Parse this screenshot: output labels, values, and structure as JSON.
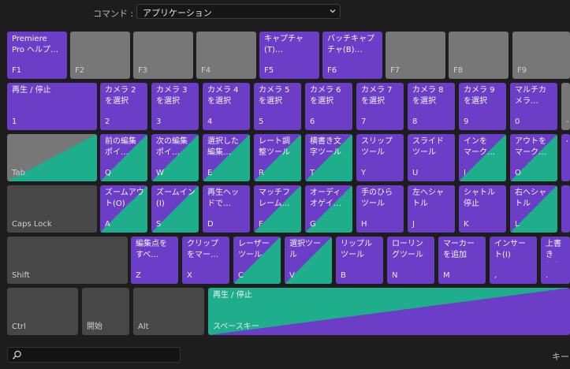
{
  "header": {
    "command_label": "コマンド :",
    "command_value": "アプリケーション"
  },
  "rows": [
    [
      {
        "id": "f1",
        "label": "Premiere\nPro ヘルプ…",
        "key": "F1",
        "style": "purple"
      },
      {
        "id": "f2",
        "label": "",
        "key": "F2",
        "style": "gray"
      },
      {
        "id": "f3",
        "label": "",
        "key": "F3",
        "style": "gray"
      },
      {
        "id": "f4",
        "label": "",
        "key": "F4",
        "style": "gray"
      },
      {
        "id": "f5",
        "label": "キャプチャ\n(T)…",
        "key": "F5",
        "style": "purple"
      },
      {
        "id": "f6",
        "label": "バッチキャプ\nチャ(B)…",
        "key": "F6",
        "style": "purple"
      },
      {
        "id": "f7",
        "label": "",
        "key": "F7",
        "style": "gray"
      },
      {
        "id": "f8",
        "label": "",
        "key": "F8",
        "style": "gray"
      },
      {
        "id": "f9",
        "label": "",
        "key": "F9",
        "style": "gray"
      }
    ],
    [
      {
        "id": "1",
        "label": "再生 / 停止",
        "key": "1",
        "style": "purple"
      },
      {
        "id": "2",
        "label": "カメラ 2\nを選択",
        "key": "2",
        "style": "purple"
      },
      {
        "id": "3",
        "label": "カメラ 3\nを選択",
        "key": "3",
        "style": "purple"
      },
      {
        "id": "4",
        "label": "カメラ 4\nを選択",
        "key": "4",
        "style": "purple"
      },
      {
        "id": "5",
        "label": "カメラ 5\nを選択",
        "key": "5",
        "style": "purple"
      },
      {
        "id": "6",
        "label": "カメラ 6\nを選択",
        "key": "6",
        "style": "purple"
      },
      {
        "id": "7",
        "label": "カメラ 7\nを選択",
        "key": "7",
        "style": "purple"
      },
      {
        "id": "8",
        "label": "カメラ 8\nを選択",
        "key": "8",
        "style": "purple"
      },
      {
        "id": "9",
        "label": "カメラ 9\nを選択",
        "key": "9",
        "style": "purple"
      },
      {
        "id": "0",
        "label": "マルチカ\nメラ…",
        "key": "0",
        "style": "purple"
      },
      {
        "id": "minus",
        "label": "",
        "key": "-",
        "style": "gray"
      }
    ],
    [
      {
        "id": "tab",
        "label": "",
        "key": "Tab",
        "style": "tab-split"
      },
      {
        "id": "q",
        "label": "前の編集\nポイ…",
        "key": "Q",
        "style": "split"
      },
      {
        "id": "w",
        "label": "次の編集\nポイ…",
        "key": "W",
        "style": "split"
      },
      {
        "id": "e",
        "label": "選択した\n編集…",
        "key": "E",
        "style": "split"
      },
      {
        "id": "r",
        "label": "レート調\n整ツール",
        "key": "R",
        "style": "split"
      },
      {
        "id": "t",
        "label": "横書き文\n字ツール",
        "key": "T",
        "style": "split"
      },
      {
        "id": "y",
        "label": "スリップ\nツール",
        "key": "Y",
        "style": "purple"
      },
      {
        "id": "u",
        "label": "スライド\nツール",
        "key": "U",
        "style": "purple"
      },
      {
        "id": "i",
        "label": "インを\nマーク…",
        "key": "I",
        "style": "split"
      },
      {
        "id": "o",
        "label": "アウトを\nマーク…",
        "key": "O",
        "style": "split"
      },
      {
        "id": "p",
        "label": "ペ",
        "key": "",
        "style": "purple"
      }
    ],
    [
      {
        "id": "capslock",
        "label": "",
        "key": "Caps Lock",
        "style": "dark"
      },
      {
        "id": "a",
        "label": "ズームアウ\nト(O)",
        "key": "A",
        "style": "split"
      },
      {
        "id": "s",
        "label": "ズームイン\n(I)",
        "key": "S",
        "style": "split"
      },
      {
        "id": "d",
        "label": "再生ヘッ\nドで…",
        "key": "D",
        "style": "purple"
      },
      {
        "id": "f",
        "label": "マッチフ\nレーム…",
        "key": "F",
        "style": "split"
      },
      {
        "id": "g",
        "label": "オーディ\nオゲイ…",
        "key": "G",
        "style": "split"
      },
      {
        "id": "h",
        "label": "手のひら\nツール",
        "key": "H",
        "style": "purple"
      },
      {
        "id": "j",
        "label": "左へシャ\nトル",
        "key": "J",
        "style": "purple"
      },
      {
        "id": "k",
        "label": "シャトル\n停止",
        "key": "K",
        "style": "purple"
      },
      {
        "id": "l",
        "label": "右へシャ\nトル",
        "key": "L",
        "style": "split"
      },
      {
        "id": "semi",
        "label": "",
        "key": "",
        "style": "purple"
      }
    ],
    [
      {
        "id": "shift",
        "label": "",
        "key": "Shift",
        "style": "dark"
      },
      {
        "id": "z",
        "label": "編集点を\nすべ…",
        "key": "Z",
        "style": "purple"
      },
      {
        "id": "x",
        "label": "クリップ\nをマー…",
        "key": "X",
        "style": "purple"
      },
      {
        "id": "c",
        "label": "レーザー\nツール",
        "key": "C",
        "style": "split"
      },
      {
        "id": "v",
        "label": "選択ツー\nル",
        "key": "V",
        "style": "split"
      },
      {
        "id": "b",
        "label": "リップル\nツール",
        "key": "B",
        "style": "purple"
      },
      {
        "id": "n",
        "label": "ローリン\nグツール",
        "key": "N",
        "style": "purple"
      },
      {
        "id": "m",
        "label": "マーカー\nを追加",
        "key": "M",
        "style": "purple"
      },
      {
        "id": "comma",
        "label": "インサー\nト(I)",
        "key": ",",
        "style": "purple"
      },
      {
        "id": "period",
        "label": "上書き\n(O)",
        "key": ".",
        "style": "purple"
      }
    ],
    [
      {
        "id": "ctrl",
        "label": "",
        "key": "Ctrl",
        "style": "dark"
      },
      {
        "id": "start",
        "label": "",
        "key": "開始",
        "style": "dark"
      },
      {
        "id": "alt",
        "label": "",
        "key": "Alt",
        "style": "dark"
      },
      {
        "id": "space",
        "label": "再生 / 停止",
        "key": "スペースキー",
        "style": "space-split"
      }
    ]
  ],
  "footer": {
    "search_placeholder": "",
    "right_text": "キー"
  },
  "colors": {
    "purple": "#6c3ec7",
    "teal": "#1fae8b",
    "gray": "#777777",
    "dark": "#474747",
    "background": "#1d1d1d"
  },
  "icons": {
    "search": "search-icon",
    "dropdown": "chevron-down-icon"
  }
}
